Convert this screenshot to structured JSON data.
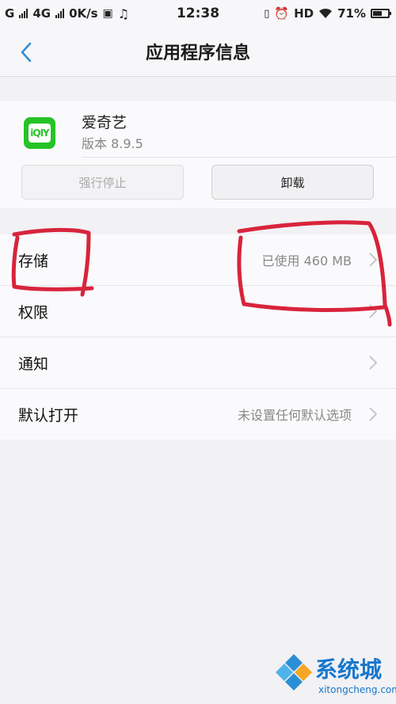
{
  "status_bar": {
    "carrier_1": "G",
    "carrier_2": "4G",
    "speed": "0K/s",
    "time": "12:38",
    "hd": "HD",
    "battery": "71%",
    "battery_level": 0.71
  },
  "header": {
    "title": "应用程序信息"
  },
  "app": {
    "name": "爱奇艺",
    "version": "版本 8.9.5",
    "icon_text": "iQIY",
    "force_stop_label": "强行停止",
    "uninstall_label": "卸载"
  },
  "settings": [
    {
      "label": "存储",
      "value": "已使用 460 MB"
    },
    {
      "label": "权限",
      "value": ""
    },
    {
      "label": "通知",
      "value": ""
    },
    {
      "label": "默认打开",
      "value": "未设置任何默认选项"
    }
  ],
  "watermark": {
    "brand": "系统城",
    "url": "xitongcheng.com"
  },
  "colors": {
    "annotation_red": "#d8243c",
    "app_icon_green": "#26c326",
    "accent_blue": "#2a8fd6"
  }
}
